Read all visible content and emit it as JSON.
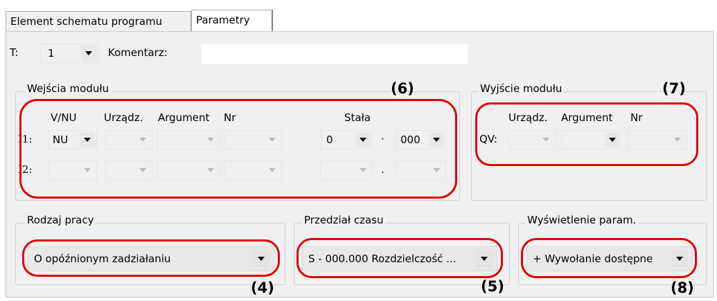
{
  "tabs": [
    {
      "label": "Element schematu programu"
    },
    {
      "label": "Parametry"
    }
  ],
  "top_row": {
    "t_label": "T:",
    "t_value": "1",
    "comment_label": "Komentarz:",
    "comment_value": ""
  },
  "inputs_group": {
    "title": "Wejścia modułu",
    "headers": {
      "vnu": "V/NU",
      "device": "Urządz.",
      "argument": "Argument",
      "nr": "Nr",
      "const": "Stała"
    },
    "rows": [
      {
        "label": "I1:",
        "vnu": "NU",
        "const_a": "0",
        "separator": "·",
        "const_b": "000"
      },
      {
        "label": "I2:",
        "vnu": "",
        "const_a": "",
        "separator": ".",
        "const_b": ""
      }
    ]
  },
  "output_group": {
    "title": "Wyjście modułu",
    "headers": {
      "device": "Urządz.",
      "argument": "Argument",
      "nr": "Nr"
    },
    "row_label": "QV:"
  },
  "operation_group": {
    "title": "Rodzaj pracy",
    "value": "O opóźnionym zadziałaniu"
  },
  "time_group": {
    "title": "Przedział czasu",
    "value": "S - 000.000 Rozdzielczość ..."
  },
  "display_group": {
    "title": "Wyświetlenie param.",
    "value": "+ Wywołanie dostępne"
  },
  "callouts": {
    "c4": "(4)",
    "c5": "(5)",
    "c6": "(6)",
    "c7": "(7)",
    "c8": "(8)"
  },
  "colors": {
    "highlight": "#e00000",
    "panel": "#f0f0f0"
  }
}
